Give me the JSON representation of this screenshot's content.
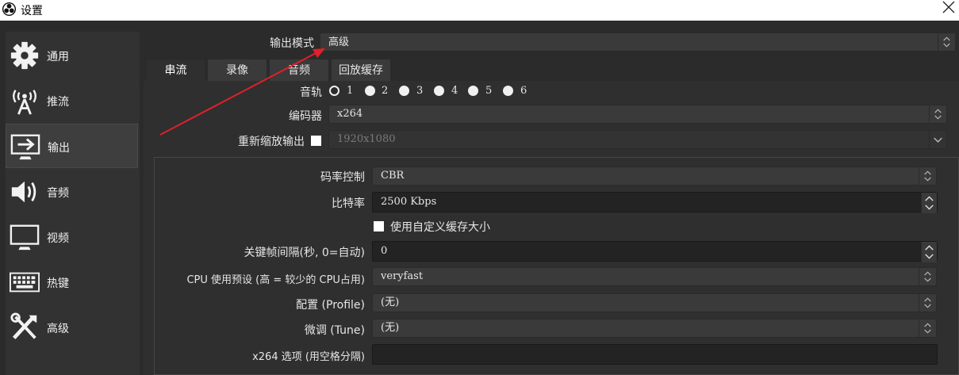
{
  "window": {
    "title": "设置"
  },
  "sidebar": {
    "items": [
      {
        "label": "通用",
        "icon": "gear-icon"
      },
      {
        "label": "推流",
        "icon": "broadcast-icon"
      },
      {
        "label": "输出",
        "icon": "output-icon",
        "active": true
      },
      {
        "label": "音频",
        "icon": "speaker-icon"
      },
      {
        "label": "视频",
        "icon": "monitor-icon"
      },
      {
        "label": "热键",
        "icon": "keyboard-icon"
      },
      {
        "label": "高级",
        "icon": "tools-icon"
      }
    ]
  },
  "output_mode": {
    "label": "输出模式",
    "value": "高级"
  },
  "tabs": [
    {
      "label": "串流",
      "active": true
    },
    {
      "label": "录像"
    },
    {
      "label": "音频"
    },
    {
      "label": "回放缓存"
    }
  ],
  "audio_track": {
    "label": "音轨",
    "options": [
      "1",
      "2",
      "3",
      "4",
      "5",
      "6"
    ],
    "selected": "1"
  },
  "encoder": {
    "label": "编码器",
    "value": "x264"
  },
  "rescale": {
    "label": "重新缩放输出",
    "checked": false,
    "value": "1920x1080"
  },
  "rate_control": {
    "label": "码率控制",
    "value": "CBR"
  },
  "bitrate": {
    "label": "比特率",
    "value": "2500 Kbps"
  },
  "custom_buffer": {
    "label": "使用自定义缓存大小",
    "checked": false
  },
  "keyframe": {
    "label": "关键帧间隔(秒, 0=自动)",
    "value": "0"
  },
  "cpu_preset": {
    "label": "CPU 使用预设 (高 = 较少的 CPU占用)",
    "value": "veryfast"
  },
  "profile": {
    "label": "配置 (Profile)",
    "value": "(无)"
  },
  "tune": {
    "label": "微调 (Tune)",
    "value": "(无)"
  },
  "x264_opts": {
    "label": "x264 选项 (用空格分隔)",
    "value": ""
  },
  "colors": {
    "annotation_arrow": "#e0202a"
  }
}
